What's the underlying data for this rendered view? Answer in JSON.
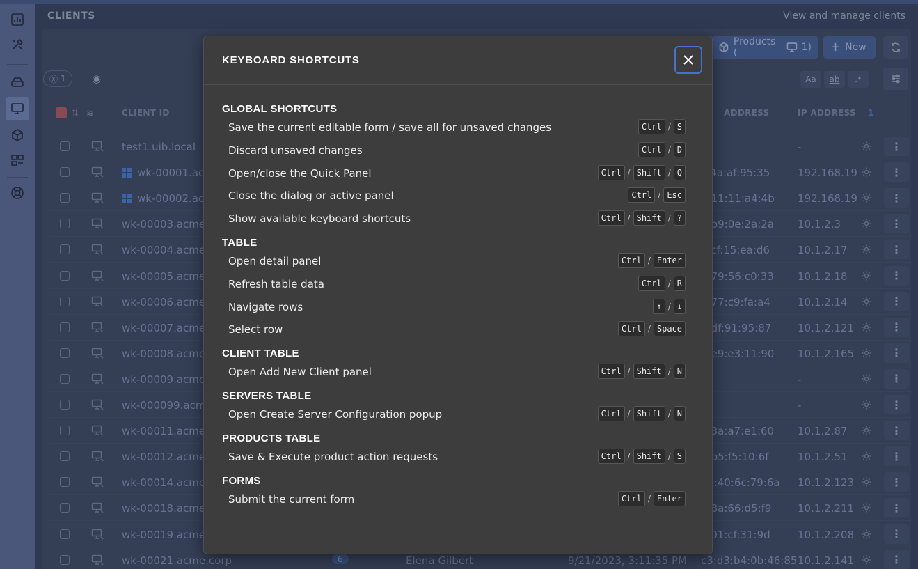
{
  "app": {
    "page_title": "CLIENTS",
    "page_subtitle": "View and manage clients"
  },
  "toolbar": {
    "products_label": "Products (",
    "products_count": "1)",
    "new_label": "New",
    "filter_count": "1",
    "case_toggle": "Aa",
    "word_toggle": "ab",
    "regex_toggle": ".*"
  },
  "table": {
    "headers": {
      "client_id": "CLIENT ID",
      "mac_address": "ADDRESS",
      "ip_address": "IP ADDRESS",
      "count": "1"
    },
    "rows": [
      {
        "id": "test1.uib.local",
        "mac": "",
        "ip": "-",
        "os": "none"
      },
      {
        "id": "wk-00001.acm",
        "mac": "c:4a:af:95:35",
        "ip": "192.168.19",
        "os": "windows"
      },
      {
        "id": "wk-00002.acm",
        "mac": "4:11:11:a4:4b",
        "ip": "192.168.19",
        "os": "windows"
      },
      {
        "id": "wk-00003.acme.co",
        "mac": "d:b9:0e:2a:2a",
        "ip": "10.1.2.3",
        "os": "none"
      },
      {
        "id": "wk-00004.acme.co",
        "mac": "a:cf:15:ea:d6",
        "ip": "10.1.2.17",
        "os": "none"
      },
      {
        "id": "wk-00005.acme.co",
        "mac": "5:79:56:c0:33",
        "ip": "10.1.2.18",
        "os": "none"
      },
      {
        "id": "wk-00006.acme.co",
        "mac": "0:77:c9:fa:a4",
        "ip": "10.1.2.14",
        "os": "none"
      },
      {
        "id": "wk-00007.acme.co",
        "mac": "0:df:91:95:87",
        "ip": "10.1.2.121",
        "os": "none"
      },
      {
        "id": "wk-00008.acme.co",
        "mac": "d:e9:e3:11:90",
        "ip": "10.1.2.165",
        "os": "none"
      },
      {
        "id": "wk-00009.acme.co",
        "mac": "",
        "ip": "-",
        "os": "none"
      },
      {
        "id": "wk-000099.acme.",
        "mac": "",
        "ip": "-",
        "os": "none"
      },
      {
        "id": "wk-00011.acme.co",
        "mac": "6:3a:a7:e1:60",
        "ip": "10.1.2.87",
        "os": "none"
      },
      {
        "id": "wk-00012.acme.co",
        "mac": "6:b5:f5:10:6f",
        "ip": "10.1.2.51",
        "os": "none"
      },
      {
        "id": "wk-00014.acme.co",
        "mac": "ba:40:6c:79:6a",
        "ip": "10.1.2.123",
        "os": "none"
      },
      {
        "id": "wk-00018.acme.co",
        "mac": "3:8a:66:d5:f9",
        "ip": "10.1.2.211",
        "os": "none"
      },
      {
        "id": "wk-00019.acme.co",
        "mac": "a:01:cf:31:9d",
        "ip": "10.1.2.208",
        "os": "none"
      },
      {
        "id": "wk-00021.acme.corp",
        "mac": "c3:d3:b4:0b:46:85",
        "ip": "10.1.2.141",
        "os": "none",
        "badge": "6",
        "user": "Elena Gilbert",
        "date": "9/21/2023, 3:11:35 PM"
      }
    ]
  },
  "modal": {
    "title": "KEYBOARD SHORTCUTS",
    "sections": [
      {
        "title": "GLOBAL SHORTCUTS",
        "items": [
          {
            "label": "Save the current editable form / save all for unsaved changes",
            "keys": [
              "Ctrl",
              "S"
            ]
          },
          {
            "label": "Discard unsaved changes",
            "keys": [
              "Ctrl",
              "D"
            ]
          },
          {
            "label": "Open/close the Quick Panel",
            "keys": [
              "Ctrl",
              "Shift",
              "Q"
            ]
          },
          {
            "label": "Close the dialog or active panel",
            "keys": [
              "Ctrl",
              "Esc"
            ]
          },
          {
            "label": "Show available keyboard shortcuts",
            "keys": [
              "Ctrl",
              "Shift",
              "?"
            ]
          }
        ]
      },
      {
        "title": "TABLE",
        "items": [
          {
            "label": "Open detail panel",
            "keys": [
              "Ctrl",
              "Enter"
            ]
          },
          {
            "label": "Refresh table data",
            "keys": [
              "Ctrl",
              "R"
            ]
          },
          {
            "label": "Navigate rows",
            "keys": [
              "↑",
              "↓"
            ]
          },
          {
            "label": "Select row",
            "keys": [
              "Ctrl",
              "Space"
            ]
          }
        ]
      },
      {
        "title": "CLIENT TABLE",
        "items": [
          {
            "label": "Open Add New Client panel",
            "keys": [
              "Ctrl",
              "Shift",
              "N"
            ]
          }
        ]
      },
      {
        "title": "SERVERS TABLE",
        "items": [
          {
            "label": "Open Create Server Configuration popup",
            "keys": [
              "Ctrl",
              "Shift",
              "N"
            ]
          }
        ]
      },
      {
        "title": "PRODUCTS TABLE",
        "items": [
          {
            "label": "Save & Execute product action requests",
            "keys": [
              "Ctrl",
              "Shift",
              "S"
            ]
          }
        ]
      },
      {
        "title": "FORMS",
        "items": [
          {
            "label": "Submit the current form",
            "keys": [
              "Ctrl",
              "Enter"
            ]
          }
        ]
      }
    ]
  },
  "colors": {
    "sidebar": "#4a577a",
    "modal_bg": "#3d3d3d",
    "focus_ring": "#4a6fcf"
  }
}
